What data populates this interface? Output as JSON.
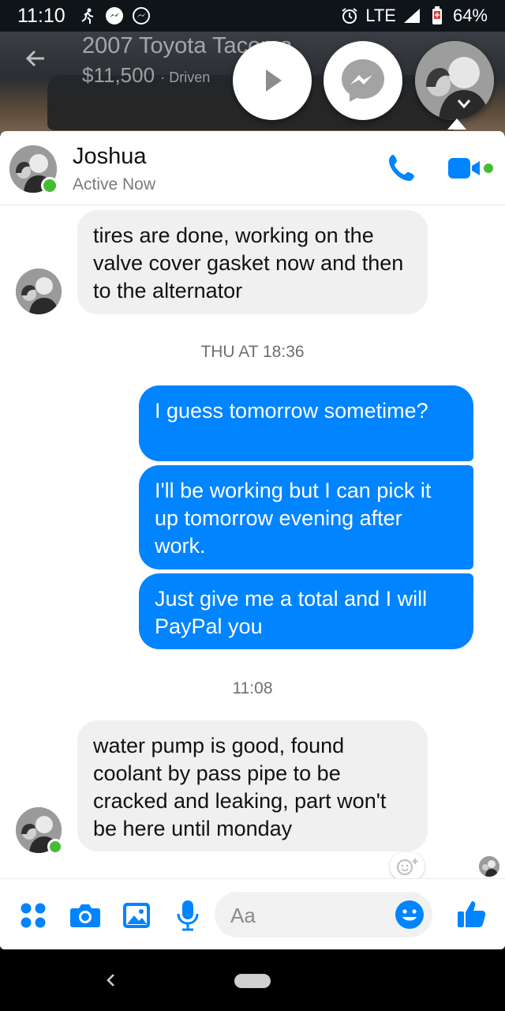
{
  "status_bar": {
    "time": "11:10",
    "network": "LTE",
    "battery": "64%"
  },
  "marketplace": {
    "title": "2007 Toyota Tacoma",
    "price": "$11,500",
    "detail": "Driven"
  },
  "header": {
    "name": "Joshua",
    "status": "Active Now"
  },
  "messages": {
    "m1": "tires are done, working on the valve cover gasket now and then to the alternator",
    "ts1": "THU AT 18:36",
    "m2": "I guess tomorrow sometime?",
    "m3": "I'll be working but I can pick it up tomorrow evening after work.",
    "m4": "Just give me a total and I will PayPal you",
    "ts2": "11:08",
    "m5": "water pump is good, found coolant by pass pipe to be cracked and leaking, part won't be here until monday"
  },
  "composer": {
    "placeholder": "Aa"
  },
  "colors": {
    "accent": "#0084ff",
    "online": "#44bd32",
    "incoming_bubble": "#f1f0f0"
  }
}
